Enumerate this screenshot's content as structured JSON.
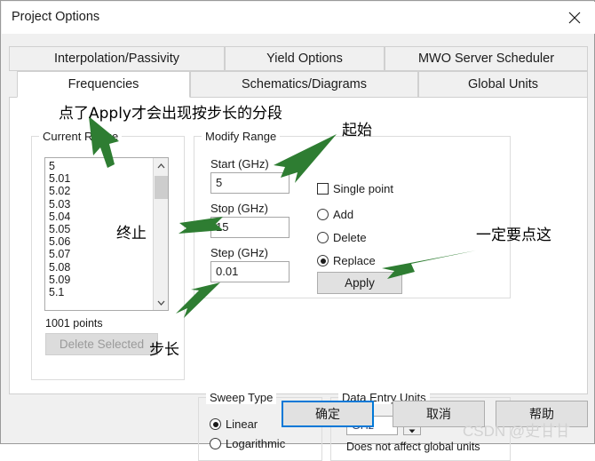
{
  "window": {
    "title": "Project Options",
    "close_icon": "close-icon"
  },
  "tabs": {
    "row1": [
      {
        "label": "Interpolation/Passivity",
        "active": false
      },
      {
        "label": "Yield Options",
        "active": false
      },
      {
        "label": "MWO Server Scheduler",
        "active": false
      }
    ],
    "row2": [
      {
        "label": "Frequencies",
        "active": true
      },
      {
        "label": "Schematics/Diagrams",
        "active": false
      },
      {
        "label": "Global Units",
        "active": false
      }
    ]
  },
  "current_range": {
    "title": "Current Range",
    "items": [
      "5",
      "5.01",
      "5.02",
      "5.03",
      "5.04",
      "5.05",
      "5.06",
      "5.07",
      "5.08",
      "5.09",
      "5.1"
    ],
    "scroll_up_icon": "chevron-up-icon",
    "scroll_down_icon": "chevron-down-icon",
    "points_label": "1001 points",
    "delete_selected_label": "Delete Selected",
    "delete_selected_enabled": false
  },
  "modify_range": {
    "title": "Modify Range",
    "start_label": "Start (GHz)",
    "start_value": "5",
    "stop_label": "Stop (GHz)",
    "stop_value": "15",
    "step_label": "Step (GHz)",
    "step_value": "0.01",
    "single_point_label": "Single point",
    "single_point_checked": false,
    "add_label": "Add",
    "delete_label": "Delete",
    "replace_label": "Replace",
    "selected_mode": "Replace",
    "apply_label": "Apply"
  },
  "sweep_type": {
    "title": "Sweep Type",
    "linear_label": "Linear",
    "logarithmic_label": "Logarithmic",
    "selected": "Linear"
  },
  "data_entry_units": {
    "title": "Data Entry Units",
    "unit_value": "GHz",
    "spinner_up_icon": "spinner-up-icon",
    "spinner_down_icon": "spinner-down-icon",
    "note": "Does not affect global units"
  },
  "footer": {
    "ok_label": "确定",
    "cancel_label": "取消",
    "help_label": "帮助"
  },
  "annotations": {
    "apply_note": "点了Apply才会出现按步长的分段",
    "start": "起始",
    "stop": "终止",
    "step": "步长",
    "click_here": "一定要点这",
    "arrow_color": "#2e7d32"
  },
  "watermark": "CSDN @史甘甘"
}
